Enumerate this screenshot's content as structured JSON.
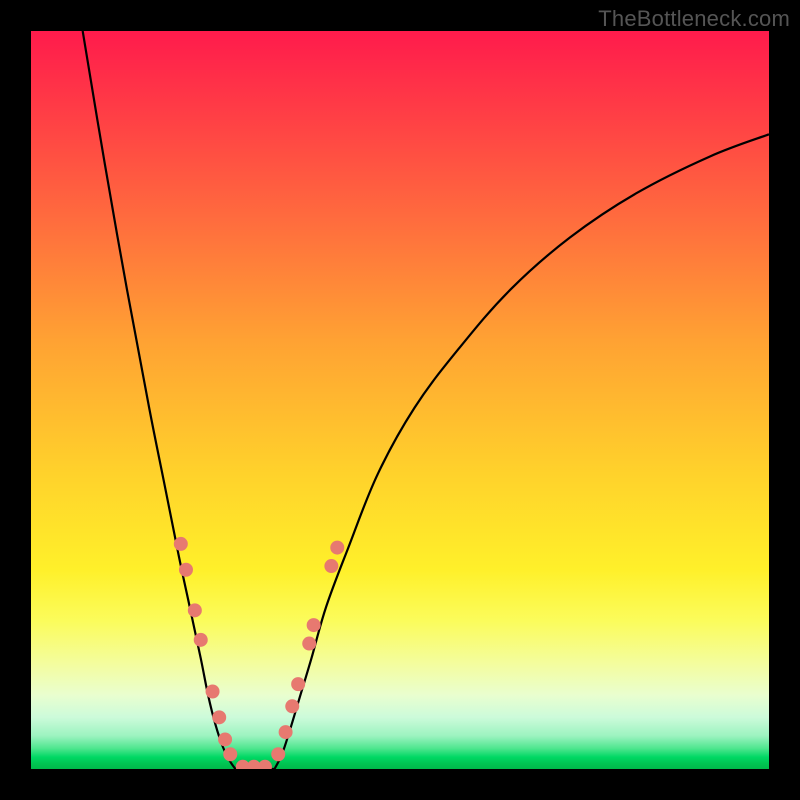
{
  "watermark": "TheBottleneck.com",
  "colors": {
    "frame": "#000000",
    "curve": "#000000",
    "dots": "#e77970",
    "gradient_top": "#ff1b4c",
    "gradient_bottom": "#00b84a"
  },
  "chart_data": {
    "type": "line",
    "title": "",
    "xlabel": "",
    "ylabel": "",
    "xlim": [
      0,
      100
    ],
    "ylim": [
      0,
      100
    ],
    "note": "Axes unlabeled in source image; x interpreted as horizontal position 0–100 (left→right), y as vertical 0–100 (bottom→top). Values estimated from pixel positions.",
    "series": [
      {
        "name": "left-arm",
        "x": [
          7,
          10,
          13,
          16,
          18,
          20,
          21.5,
          23,
          24,
          25,
          26,
          27,
          27.7
        ],
        "values": [
          100,
          82,
          65,
          49,
          39,
          29,
          22,
          15,
          10,
          6,
          3,
          1,
          0
        ]
      },
      {
        "name": "floor",
        "x": [
          27.7,
          29,
          31,
          33
        ],
        "values": [
          0,
          0,
          0,
          0
        ]
      },
      {
        "name": "right-arm",
        "x": [
          33,
          34,
          35,
          36.5,
          38,
          40,
          43,
          47,
          52,
          58,
          65,
          73,
          82,
          92,
          100
        ],
        "values": [
          0,
          2,
          5,
          10,
          15,
          22,
          30,
          40,
          49,
          57,
          65,
          72,
          78,
          83,
          86
        ]
      }
    ],
    "markers": [
      {
        "x": 20.3,
        "y": 30.5
      },
      {
        "x": 21.0,
        "y": 27.0
      },
      {
        "x": 22.2,
        "y": 21.5
      },
      {
        "x": 23.0,
        "y": 17.5
      },
      {
        "x": 24.6,
        "y": 10.5
      },
      {
        "x": 25.5,
        "y": 7.0
      },
      {
        "x": 26.3,
        "y": 4.0
      },
      {
        "x": 27.0,
        "y": 2.0
      },
      {
        "x": 28.7,
        "y": 0.3
      },
      {
        "x": 30.2,
        "y": 0.3
      },
      {
        "x": 31.7,
        "y": 0.3
      },
      {
        "x": 33.5,
        "y": 2.0
      },
      {
        "x": 34.5,
        "y": 5.0
      },
      {
        "x": 35.4,
        "y": 8.5
      },
      {
        "x": 36.2,
        "y": 11.5
      },
      {
        "x": 37.7,
        "y": 17.0
      },
      {
        "x": 38.3,
        "y": 19.5
      },
      {
        "x": 40.7,
        "y": 27.5
      },
      {
        "x": 41.5,
        "y": 30.0
      }
    ]
  }
}
